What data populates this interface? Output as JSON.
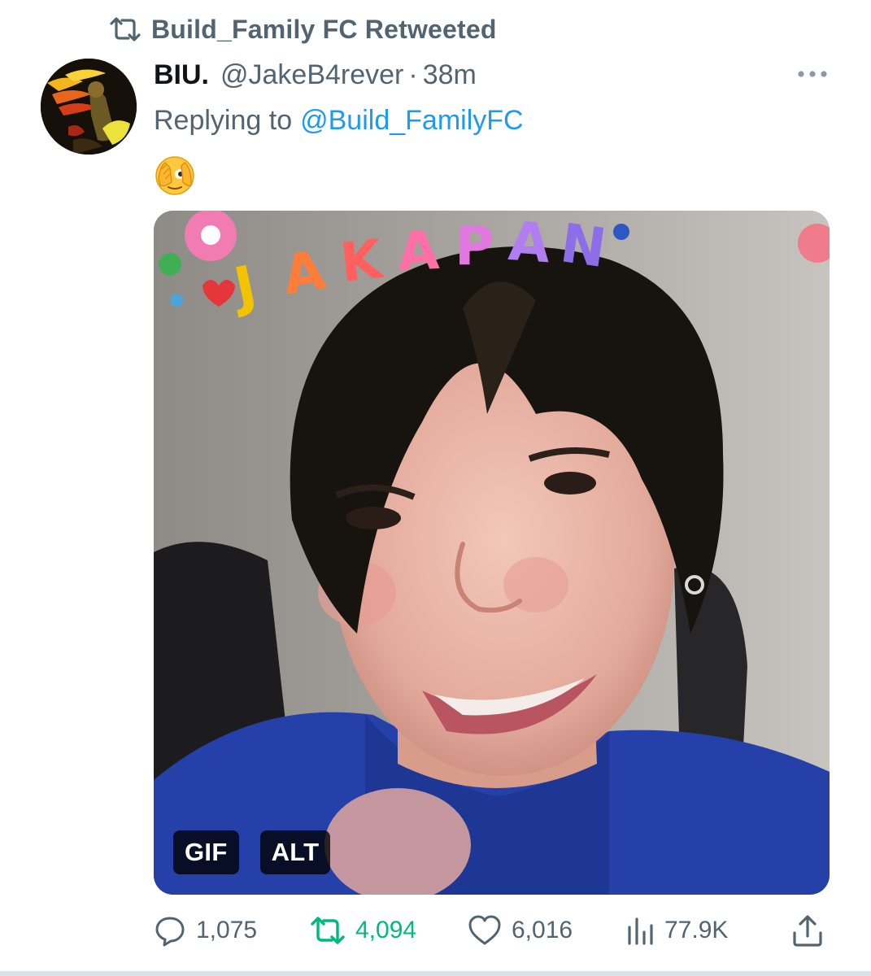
{
  "retweet_context": {
    "icon": "retweet-icon",
    "text": "Build_Family FC Retweeted"
  },
  "tweet": {
    "avatar": "user-avatar",
    "display_name": "BIU.",
    "handle": "@JakeB4rever",
    "separator": "·",
    "time": "38m",
    "replying_label": "Replying to",
    "replying_to": "@Build_FamilyFC",
    "text": "🫣",
    "more_icon": "more-horizontal-icon"
  },
  "media": {
    "overlay_text": "JAKAPAN",
    "badges": [
      "GIF",
      "ALT"
    ]
  },
  "actions": {
    "reply": {
      "icon": "reply-icon",
      "count": "1,075"
    },
    "retweet": {
      "icon": "retweet-icon",
      "count": "4,094",
      "active": true,
      "color": "#00ba7c"
    },
    "like": {
      "icon": "heart-icon",
      "count": "6,016"
    },
    "views": {
      "icon": "views-icon",
      "count": "77.9K"
    },
    "share": {
      "icon": "share-icon"
    }
  },
  "colors": {
    "text_primary": "#0f1419",
    "text_secondary": "#536471",
    "link": "#1d9bf0",
    "retweet_active": "#00ba7c"
  }
}
